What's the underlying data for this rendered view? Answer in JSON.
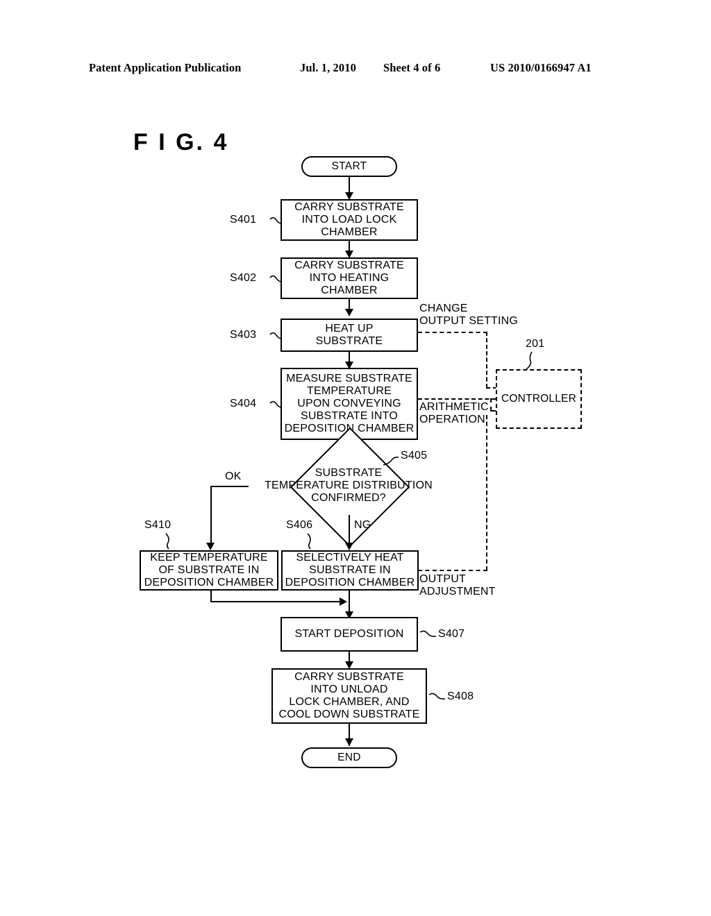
{
  "header": {
    "publication": "Patent Application Publication",
    "date": "Jul. 1, 2010",
    "sheet": "Sheet 4 of 6",
    "patent_number": "US 2010/0166947 A1"
  },
  "figure": {
    "title": "F I G.  4"
  },
  "flowchart": {
    "start": {
      "label": "START"
    },
    "end": {
      "label": "END"
    },
    "steps": [
      {
        "id": "S401",
        "text": "CARRY SUBSTRATE\nINTO LOAD LOCK\nCHAMBER"
      },
      {
        "id": "S402",
        "text": "CARRY SUBSTRATE\nINTO HEATING\nCHAMBER"
      },
      {
        "id": "S403",
        "text": "HEAT UP\nSUBSTRATE"
      },
      {
        "id": "S404",
        "text": "MEASURE SUBSTRATE\nTEMPERATURE\nUPON CONVEYING\nSUBSTRATE INTO\nDEPOSITION CHAMBER"
      },
      {
        "id": "S405",
        "text": "SUBSTRATE\nTEMPERATURE DISTRIBUTION\nCONFIRMED?"
      },
      {
        "id": "S410",
        "text": "KEEP TEMPERATURE\nOF SUBSTRATE IN\nDEPOSITION CHAMBER"
      },
      {
        "id": "S406",
        "text": "SELECTIVELY HEAT\nSUBSTRATE IN\nDEPOSITION CHAMBER"
      },
      {
        "id": "S407",
        "text": "START DEPOSITION"
      },
      {
        "id": "S408",
        "text": "CARRY SUBSTRATE\nINTO UNLOAD\nLOCK CHAMBER, AND\nCOOL DOWN SUBSTRATE"
      }
    ],
    "branches": {
      "ok": "OK",
      "ng": "NG"
    },
    "controller": {
      "label": "CONTROLLER",
      "reference": "201",
      "signals": {
        "change_output_setting": "CHANGE\nOUTPUT SETTING",
        "arithmetic_operation": "ARITHMETIC\nOPERATION",
        "output_adjustment": "OUTPUT\nADJUSTMENT"
      }
    }
  }
}
